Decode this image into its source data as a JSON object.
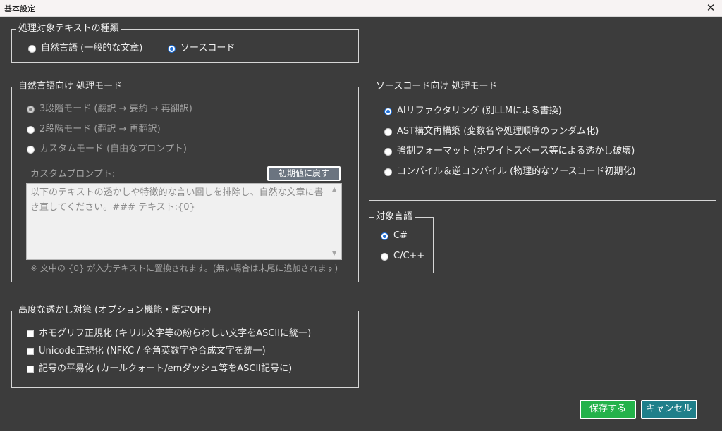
{
  "window": {
    "title": "基本設定",
    "close_glyph": "✕"
  },
  "target_type": {
    "legend": "処理対象テキストの種類",
    "options": [
      {
        "label": "自然言語 (一般的な文章)",
        "checked": false
      },
      {
        "label": "ソースコード",
        "checked": true
      }
    ]
  },
  "natural_mode": {
    "legend": "自然言語向け 処理モード",
    "options": [
      {
        "label": "3段階モード (翻訳 → 要約 → 再翻訳)",
        "checked": true
      },
      {
        "label": "2段階モード (翻訳 → 再翻訳)",
        "checked": false
      },
      {
        "label": "カスタムモード (自由なプロンプト)",
        "checked": false
      }
    ],
    "custom_prompt_label": "カスタムプロンプト:",
    "reset_button": "初期値に戻す",
    "prompt_text": "以下のテキストの透かしや特徴的な言い回しを排除し、自然な文章に書き直してください。### テキスト:{0}",
    "note": "※ 文中の {0} が入力テキストに置換されます。(無い場合は末尾に追加されます)"
  },
  "code_mode": {
    "legend": "ソースコード向け 処理モード",
    "options": [
      {
        "label": "AIリファクタリング (別LLMによる書換)",
        "checked": true
      },
      {
        "label": "AST構文再構築 (変数名や処理順序のランダム化)",
        "checked": false
      },
      {
        "label": "強制フォーマット (ホワイトスペース等による透かし破壊)",
        "checked": false
      },
      {
        "label": "コンパイル＆逆コンパイル (物理的なソースコード初期化)",
        "checked": false
      }
    ]
  },
  "language": {
    "legend": "対象言語",
    "options": [
      {
        "label": "C#",
        "checked": true
      },
      {
        "label": "C/C++",
        "checked": false
      }
    ]
  },
  "advanced": {
    "legend": "高度な透かし対策 (オプション機能・既定OFF)",
    "options": [
      {
        "label": "ホモグリフ正規化 (キリル文字等の紛らわしい文字をASCIIに統一)",
        "checked": false
      },
      {
        "label": "Unicode正規化 (NFKC / 全角英数字や合成文字を統一)",
        "checked": false
      },
      {
        "label": "記号の平易化 (カールクォート/emダッシュ等をASCII記号に)",
        "checked": false
      }
    ]
  },
  "buttons": {
    "save": "保存する",
    "cancel": "キャンセル"
  },
  "scroll": {
    "up": "▲",
    "down": "▼"
  },
  "colors": {
    "background": "#3c3c3c",
    "save_button": "#23b24a",
    "cancel_button": "#1f7f8a",
    "reset_button": "#6b7480",
    "radio_accent": "#1e6fd8"
  }
}
